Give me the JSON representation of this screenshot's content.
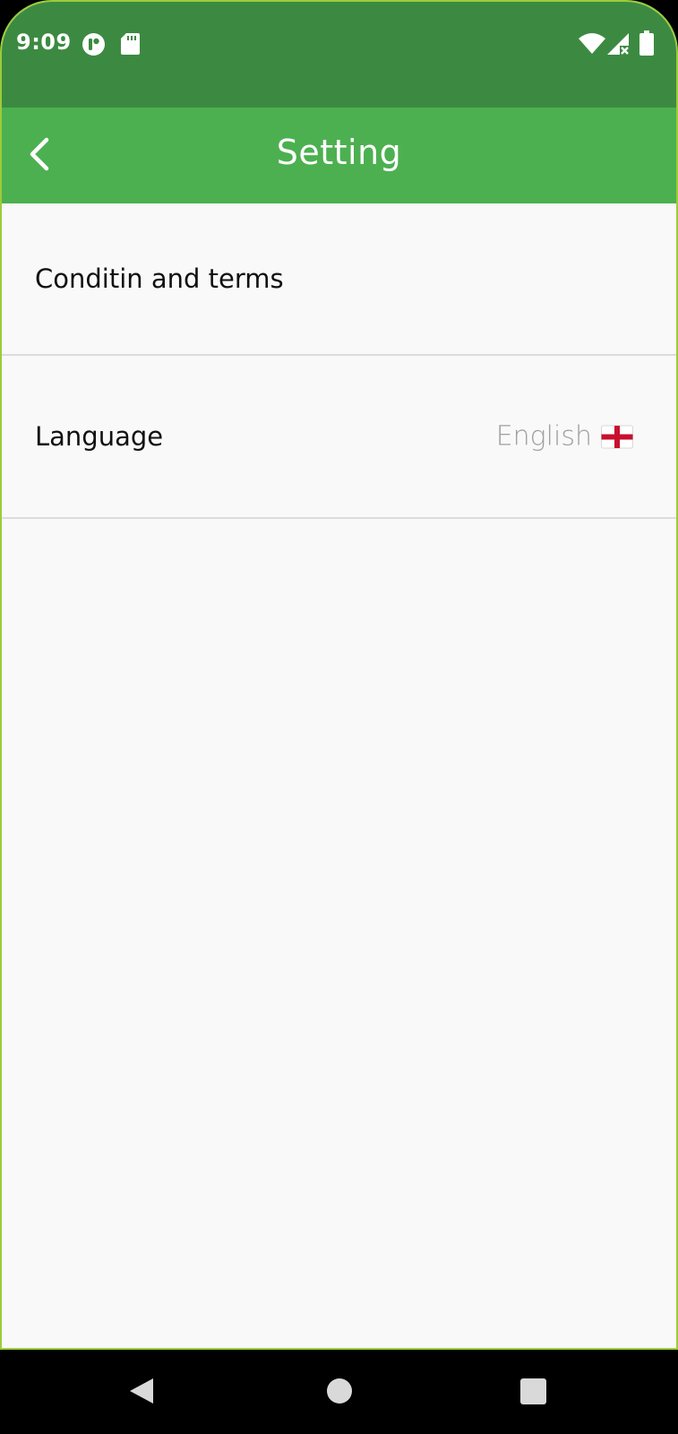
{
  "status_bar": {
    "time": "9:09",
    "left_icons": [
      "sync-badge-icon",
      "sd-card-icon"
    ],
    "right_icons": [
      "wifi-icon",
      "cellular-no-signal-icon",
      "battery-icon"
    ]
  },
  "app_bar": {
    "title": "Setting",
    "back_icon": "back-arrow-icon",
    "background_color": "#4cb050",
    "status_color": "#3c8a41"
  },
  "settings": {
    "items": [
      {
        "label": "Conditin and terms"
      },
      {
        "label": "Language",
        "value": "English",
        "flag_icon": "england-flag-icon"
      }
    ]
  },
  "nav_bar": {
    "buttons": [
      "back-triangle-icon",
      "home-circle-icon",
      "recents-square-icon"
    ]
  }
}
